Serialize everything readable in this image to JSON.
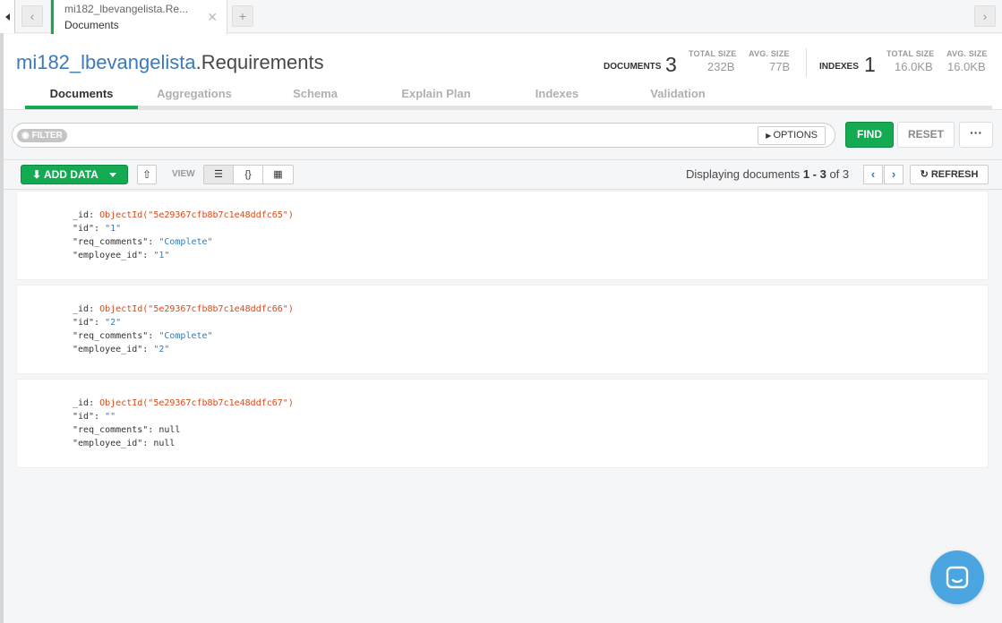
{
  "tabbar": {
    "tab_title": "mi182_lbevangelista.Re...",
    "tab_subtitle": "Documents",
    "close_glyph": "✕",
    "add_glyph": "+"
  },
  "header": {
    "db_name": "mi182_lbevangelista",
    "collection_name": ".Requirements",
    "documents_label": "DOCUMENTS",
    "documents_count": "3",
    "docs_total_size_label": "TOTAL SIZE",
    "docs_total_size": "232B",
    "docs_avg_size_label": "AVG. SIZE",
    "docs_avg_size": "77B",
    "indexes_label": "INDEXES",
    "indexes_count": "1",
    "idx_total_size_label": "TOTAL SIZE",
    "idx_total_size": "16.0KB",
    "idx_avg_size_label": "AVG. SIZE",
    "idx_avg_size": "16.0KB",
    "tabs": [
      {
        "label": "Documents",
        "active": true
      },
      {
        "label": "Aggregations"
      },
      {
        "label": "Schema"
      },
      {
        "label": "Explain Plan"
      },
      {
        "label": "Indexes"
      },
      {
        "label": "Validation"
      }
    ]
  },
  "filter": {
    "pill": "FILTER",
    "options_label": "OPTIONS",
    "find_label": "FIND",
    "reset_label": "RESET",
    "more_label": "···"
  },
  "toolbar": {
    "add_data_label": "ADD DATA",
    "view_label": "VIEW",
    "displaying_prefix": "Displaying documents",
    "range": "1 - 3",
    "of_label": "of",
    "total": "3",
    "refresh_label": "REFRESH"
  },
  "documents": [
    {
      "oid_key": "_id",
      "oid": "ObjectId(\"5e29367cfb8b7c1e48ddfc65\")",
      "id_key": "\"id\"",
      "id_val": "\"1\"",
      "req_key": "\"req_comments\"",
      "req_val": "\"Complete\"",
      "emp_key": "\"employee_id\"",
      "emp_val": "\"1\""
    },
    {
      "oid_key": "_id",
      "oid": "ObjectId(\"5e29367cfb8b7c1e48ddfc66\")",
      "id_key": "\"id\"",
      "id_val": "\"2\"",
      "req_key": "\"req_comments\"",
      "req_val": "\"Complete\"",
      "emp_key": "\"employee_id\"",
      "emp_val": "\"2\""
    },
    {
      "oid_key": "_id",
      "oid": "ObjectId(\"5e29367cfb8b7c1e48ddfc67\")",
      "id_key": "\"id\"",
      "id_val": "\"\"",
      "req_key": "\"req_comments\"",
      "req_val": "null",
      "emp_key": "\"employee_id\"",
      "emp_val": "null"
    }
  ],
  "colors": {
    "accent_green": "#13aa52",
    "db_blue": "#3d7ab8",
    "objectid_orange": "#d64a1c",
    "string_blue": "#3b79b5",
    "intercom_blue": "#4aa5e0"
  }
}
